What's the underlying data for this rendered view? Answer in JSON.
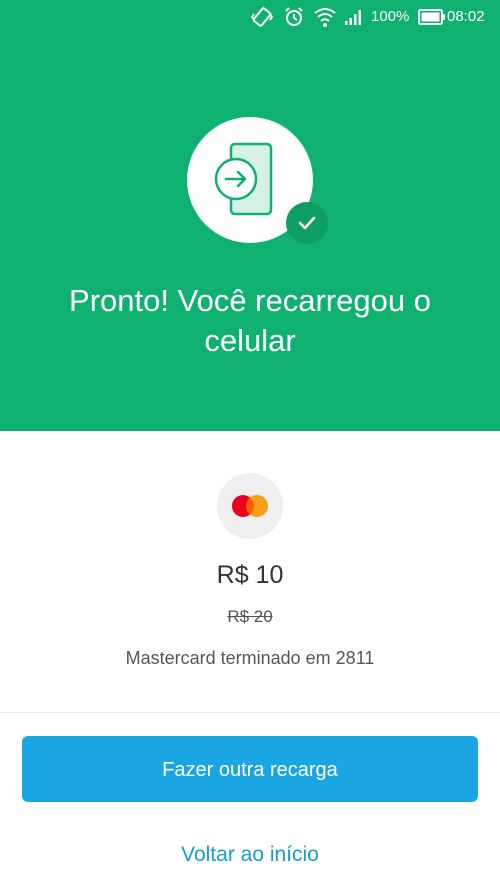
{
  "status_bar": {
    "battery_percent": "100%",
    "time": "08:02",
    "icons": [
      "vibrate-icon",
      "alarm-icon",
      "wifi-icon",
      "signal-icon",
      "battery-icon"
    ]
  },
  "hero": {
    "background_color": "#0fb170",
    "icon": "phone-recharge-icon",
    "badge_icon": "check-icon",
    "title": "Pronto! Você recarregou o celular"
  },
  "payment": {
    "card_brand_icon": "mastercard-icon",
    "amount": "R$ 10",
    "original_amount": "R$ 20",
    "card_description": "Mastercard terminado em 2811"
  },
  "actions": {
    "primary_label": "Fazer outra recarga",
    "secondary_label": "Voltar ao início",
    "primary_color": "#1aa6e3",
    "link_color": "#1a9ad8"
  }
}
